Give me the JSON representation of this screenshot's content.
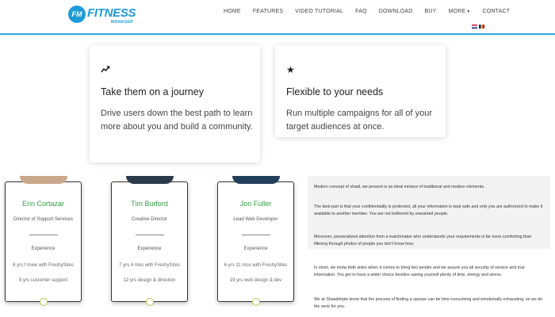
{
  "header": {
    "logo": {
      "badge": "FM",
      "brand": "FITNESS",
      "sub": "MANAGER"
    },
    "nav": [
      "HOME",
      "FEATURES",
      "VIDEO TUTORIAL",
      "FAQ",
      "DOWNLOAD",
      "BUY",
      "MORE",
      "CONTACT"
    ],
    "accent_color": "#29a8e0"
  },
  "features": [
    {
      "icon": "trending-up-icon",
      "title": "Take them on a journey",
      "text": "Drive users down the best path to learn more about you and build a community."
    },
    {
      "icon": "star-icon",
      "title": "Flexible to your needs",
      "text": "Run multiple campaigns for all of your target audiences at once."
    }
  ],
  "team": [
    {
      "name": "Erin Cortazar",
      "role": "Director of Support Services",
      "exp_label": "Experience",
      "line1": "8 yrs f rnew with FreshySites",
      "line2": "9 yrs customer support"
    },
    {
      "name": "Tim Burford",
      "role": "Creative Director",
      "exp_label": "Experience",
      "line1": "7 yrs 4 mos with FreshySites",
      "line2": "12 yrs design & direction"
    },
    {
      "name": "Jon Fuller",
      "role": "Lead Web Developer",
      "exp_label": "Experience",
      "line1": "6 yrs 11 mos with FreshySites",
      "line2": "19 yrs web design & dev"
    }
  ],
  "article": {
    "p1": "Modern concept of shadi, we present is an ideal mixture of traditional and modern elements.",
    "p2": "The best part is that your confidentiality is protected, all your information is kept safe and only you are authorized to make it available to another member. You are not bothered by unwanted people.",
    "p3": "Moreover, personalized attention from a matchmaker who understands your requirements is far more comforting than filtering through photos of people you don't know how.",
    "p4": "In short, we know both sides when it comes to bring two people and we assure you all security of service and true information. You get to have a wider choice besides saving yourself plenty of time, energy and stress.",
    "p5": "We at Shaadimple know that the process of finding a spouse can be time-consuming and emotionally exhausting, so we do the work for you."
  }
}
